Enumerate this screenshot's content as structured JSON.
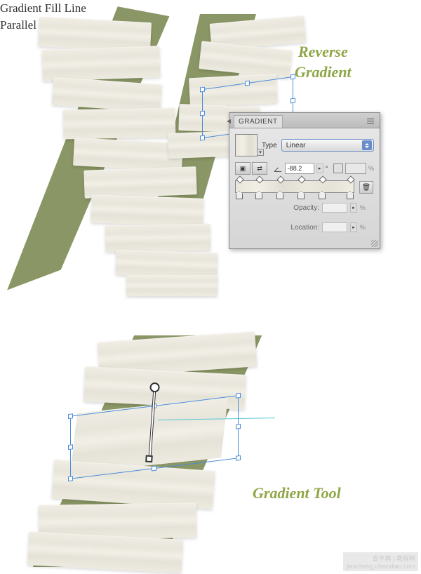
{
  "annotations": {
    "reverse_line1": "Reverse",
    "reverse_line2": "Gradient",
    "gradient_tool": "Gradient Tool",
    "fill_line1": "Gradient Fill Line",
    "fill_line2": "Parallel to Short Side"
  },
  "panel": {
    "title": "GRADIENT",
    "type_label": "Type",
    "type_value": "Linear",
    "angle_value": "-88.2",
    "degree_symbol": "°",
    "aspect_value": "",
    "opacity_label": "Opacity:",
    "opacity_value": "",
    "location_label": "Location:",
    "location_value": "",
    "percent": "%"
  },
  "watermark": {
    "line1": "查字典 | 教程网",
    "line2": "jiaocheng.chazidian.com"
  }
}
